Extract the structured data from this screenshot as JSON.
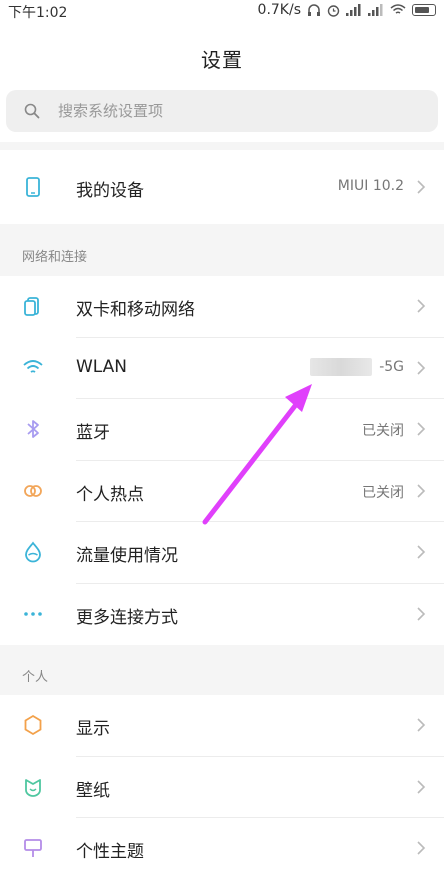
{
  "status_bar": {
    "time": "下午1:02",
    "net_speed": "0.7K/s"
  },
  "page_title": "设置",
  "search": {
    "placeholder": "搜索系统设置项",
    "icon": "search-icon"
  },
  "device_row": {
    "label": "我的设备",
    "value": "MIUI 10.2",
    "icon": "phone-icon"
  },
  "sections": {
    "network": {
      "title": "网络和连接",
      "items": [
        {
          "label": "双卡和移动网络",
          "value": "",
          "icon": "sim-card-icon"
        },
        {
          "label": "WLAN",
          "value": "-5G",
          "icon": "wifi-icon"
        },
        {
          "label": "蓝牙",
          "value": "已关闭",
          "icon": "bluetooth-icon"
        },
        {
          "label": "个人热点",
          "value": "已关闭",
          "icon": "hotspot-icon"
        },
        {
          "label": "流量使用情况",
          "value": "",
          "icon": "data-usage-icon"
        },
        {
          "label": "更多连接方式",
          "value": "",
          "icon": "more-dots-icon"
        }
      ]
    },
    "personal": {
      "title": "个人",
      "items": [
        {
          "label": "显示",
          "value": "",
          "icon": "display-icon"
        },
        {
          "label": "壁纸",
          "value": "",
          "icon": "wallpaper-icon"
        },
        {
          "label": "个性主题",
          "value": "",
          "icon": "theme-icon"
        }
      ]
    }
  },
  "colors": {
    "accent_blue": "#3bb4d8",
    "bluetooth_purple": "#a89cf0",
    "hotspot_orange": "#f2a65a",
    "display_orange": "#f3a14a",
    "wallpaper_green": "#4fc7a0",
    "theme_purple": "#b48ce8",
    "annotation_arrow": "#e040fb"
  }
}
